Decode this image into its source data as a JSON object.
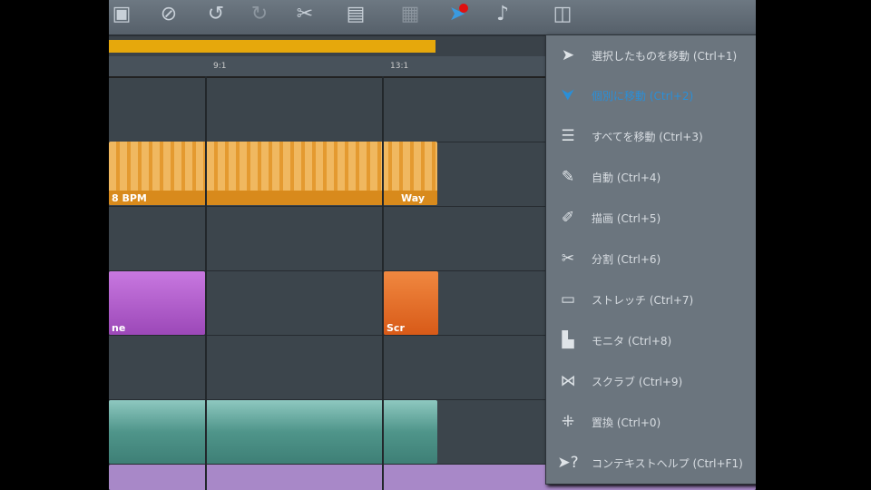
{
  "toolbar": {
    "icons": [
      "save-icon",
      "export-icon",
      "undo-icon",
      "redo-icon",
      "scissors-icon",
      "document-icon",
      "copy-icon",
      "mouse-mode-icon",
      "note-icon",
      "book-icon"
    ]
  },
  "ruler": {
    "labels": [
      "9:1",
      "13:1"
    ]
  },
  "tracks": {
    "clip1": "8 BPM",
    "clip2": "Way",
    "clip3": "ne",
    "clip4": "Scr"
  },
  "menu": {
    "items": [
      {
        "label": "選択したものを移動 (Ctrl+1)",
        "icon": "arrow-icon"
      },
      {
        "label": "個別に移動 (Ctrl+2)",
        "icon": "move-single-icon",
        "highlighted": true
      },
      {
        "label": "すべてを移動 (Ctrl+3)",
        "icon": "move-all-icon"
      },
      {
        "label": "自動 (Ctrl+4)",
        "icon": "auto-icon"
      },
      {
        "label": "描画 (Ctrl+5)",
        "icon": "pencil-icon"
      },
      {
        "label": "分割 (Ctrl+6)",
        "icon": "split-icon"
      },
      {
        "label": "ストレッチ (Ctrl+7)",
        "icon": "stretch-icon"
      },
      {
        "label": "モニタ (Ctrl+8)",
        "icon": "monitor-icon"
      },
      {
        "label": "スクラブ (Ctrl+9)",
        "icon": "scrub-icon"
      },
      {
        "label": "置換 (Ctrl+0)",
        "icon": "replace-icon"
      },
      {
        "label": "コンテキストヘルプ (Ctrl+F1)",
        "icon": "context-help-icon"
      }
    ]
  },
  "colors": {
    "accent": "#2a8fd8",
    "loop": "#e6a80c",
    "orange": "#e8a83a",
    "purple": "#b060c8",
    "teal": "#5ea59a"
  }
}
